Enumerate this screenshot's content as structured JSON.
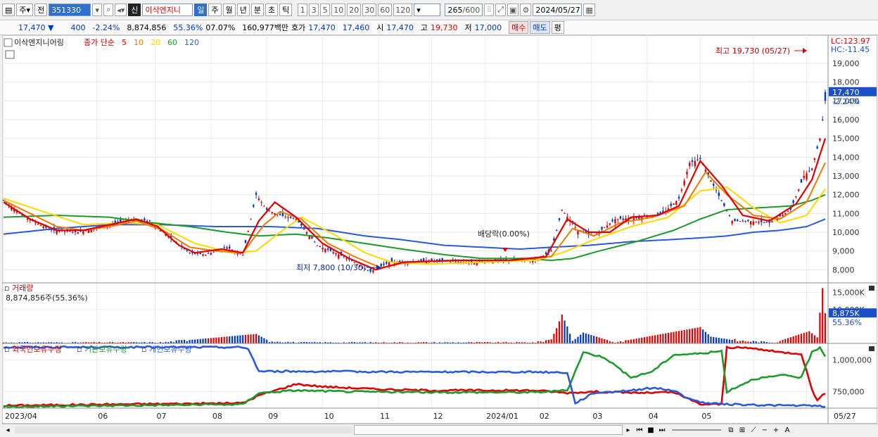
{
  "toolbar": {
    "market_btn": "주",
    "prev_btn": "전",
    "code": "351330",
    "stock_name": "이삭엔지니",
    "badge": "신",
    "periods": [
      "일",
      "주",
      "월",
      "년",
      "분",
      "초",
      "틱"
    ],
    "selected_period": "일",
    "intervals": [
      "1",
      "3",
      "5",
      "10",
      "20",
      "30",
      "60",
      "120"
    ],
    "count": "265",
    "count_total": "/600",
    "date": "2024/05/27"
  },
  "quote": {
    "price": "17,470",
    "arrow": "▼",
    "change": "400",
    "change_pct": "-2.24%",
    "volume": "8,874,856",
    "vol_ratio": "55.36%",
    "turnover": "07.07%",
    "amount": "160,977백만",
    "ask_label": "호가",
    "ask": "17,470",
    "bid": "17,460",
    "open_label": "시",
    "open": "17,470",
    "high_label": "고",
    "high": "19,730",
    "low_label": "저",
    "low": "17,000",
    "buy_btn": "매수",
    "sell_btn": "매도",
    "eval_btn": "평"
  },
  "colors": {
    "up": "#e00000",
    "down": "#0036c8",
    "ma5": "#e00000",
    "ma10": "#f07a00",
    "ma20": "#ffd800",
    "ma60": "#1e9a2c",
    "ma120": "#2a5ad8"
  },
  "chart_data": [
    {
      "type": "candlestick",
      "title": "이삭엔지니어링",
      "legend_label": "종가 단순",
      "ma_periods": [
        "5",
        "10",
        "20",
        "60",
        "120"
      ],
      "y_ticks": [
        "19,000",
        "18,000",
        "17,000",
        "16,000",
        "15,000",
        "14,000",
        "13,000",
        "12,000",
        "11,000",
        "10,000",
        "9,000",
        "8,000"
      ],
      "ylim": [
        7300,
        19900
      ],
      "lc_label": "LC:123.97",
      "hc_label": "HC:-11.45",
      "current_price_label": "17,470",
      "current_change_label": "-2.24%",
      "annotation_high": "최고 19,730 (05/27)",
      "annotation_low": "최저 7,800 (10/30)",
      "annotation_dividend": "배당락(0.00%)",
      "x_labels": [
        "2023/04",
        "06",
        "07",
        "08",
        "09",
        "10",
        "11",
        "12",
        "2024/01",
        "02",
        "03",
        "04",
        "05",
        "05/27"
      ],
      "price_path": [
        [
          0,
          11700
        ],
        [
          8,
          10800
        ],
        [
          18,
          10100
        ],
        [
          28,
          10000
        ],
        [
          38,
          10300
        ],
        [
          48,
          10700
        ],
        [
          55,
          10600
        ],
        [
          60,
          10000
        ],
        [
          70,
          8900
        ],
        [
          76,
          8800
        ],
        [
          84,
          9200
        ],
        [
          90,
          8800
        ],
        [
          95,
          12000
        ],
        [
          99,
          11200
        ],
        [
          104,
          10900
        ],
        [
          110,
          10700
        ],
        [
          118,
          9300
        ],
        [
          128,
          8700
        ],
        [
          138,
          7900
        ],
        [
          145,
          8400
        ],
        [
          160,
          8500
        ],
        [
          175,
          8400
        ],
        [
          188,
          8500
        ],
        [
          200,
          8500
        ],
        [
          206,
          9000
        ],
        [
          210,
          11200
        ],
        [
          216,
          10100
        ],
        [
          222,
          9800
        ],
        [
          230,
          10700
        ],
        [
          240,
          10800
        ],
        [
          248,
          11000
        ],
        [
          254,
          11800
        ],
        [
          258,
          13700
        ],
        [
          262,
          13900
        ],
        [
          268,
          12200
        ],
        [
          274,
          10600
        ],
        [
          280,
          10600
        ],
        [
          288,
          10500
        ],
        [
          296,
          11200
        ],
        [
          301,
          13000
        ],
        [
          304,
          13400
        ],
        [
          307,
          15000
        ],
        [
          309,
          17000
        ]
      ],
      "ma_series": {
        "ma5": [
          [
            0,
            11600
          ],
          [
            10,
            10700
          ],
          [
            20,
            10100
          ],
          [
            30,
            10100
          ],
          [
            40,
            10400
          ],
          [
            50,
            10700
          ],
          [
            58,
            10300
          ],
          [
            66,
            9300
          ],
          [
            72,
            8900
          ],
          [
            82,
            9100
          ],
          [
            90,
            8900
          ],
          [
            96,
            10600
          ],
          [
            102,
            11600
          ],
          [
            110,
            10800
          ],
          [
            120,
            9400
          ],
          [
            130,
            8600
          ],
          [
            140,
            8000
          ],
          [
            150,
            8400
          ],
          [
            170,
            8500
          ],
          [
            190,
            8500
          ],
          [
            204,
            8700
          ],
          [
            212,
            10700
          ],
          [
            220,
            10000
          ],
          [
            228,
            10000
          ],
          [
            236,
            10800
          ],
          [
            246,
            10900
          ],
          [
            254,
            11400
          ],
          [
            262,
            13800
          ],
          [
            270,
            12500
          ],
          [
            278,
            10900
          ],
          [
            288,
            10600
          ],
          [
            298,
            11500
          ],
          [
            304,
            12800
          ],
          [
            309,
            15000
          ]
        ],
        "ma10": [
          [
            0,
            11700
          ],
          [
            10,
            11000
          ],
          [
            20,
            10300
          ],
          [
            30,
            10100
          ],
          [
            40,
            10300
          ],
          [
            50,
            10600
          ],
          [
            60,
            10100
          ],
          [
            70,
            9200
          ],
          [
            80,
            9000
          ],
          [
            90,
            8900
          ],
          [
            98,
            10400
          ],
          [
            104,
            11100
          ],
          [
            112,
            10700
          ],
          [
            122,
            9400
          ],
          [
            132,
            8700
          ],
          [
            142,
            8100
          ],
          [
            152,
            8400
          ],
          [
            172,
            8500
          ],
          [
            192,
            8500
          ],
          [
            206,
            8700
          ],
          [
            214,
            10200
          ],
          [
            222,
            9800
          ],
          [
            232,
            10500
          ],
          [
            244,
            10800
          ],
          [
            256,
            11400
          ],
          [
            264,
            13200
          ],
          [
            272,
            12000
          ],
          [
            282,
            10900
          ],
          [
            292,
            10700
          ],
          [
            302,
            11600
          ],
          [
            309,
            13700
          ]
        ],
        "ma20": [
          [
            0,
            11800
          ],
          [
            15,
            11100
          ],
          [
            30,
            10400
          ],
          [
            45,
            10500
          ],
          [
            58,
            10400
          ],
          [
            72,
            9400
          ],
          [
            86,
            8900
          ],
          [
            95,
            9000
          ],
          [
            104,
            10000
          ],
          [
            112,
            10800
          ],
          [
            124,
            9900
          ],
          [
            136,
            8900
          ],
          [
            146,
            8400
          ],
          [
            160,
            8300
          ],
          [
            180,
            8400
          ],
          [
            200,
            8500
          ],
          [
            210,
            8900
          ],
          [
            222,
            9600
          ],
          [
            236,
            10300
          ],
          [
            250,
            10800
          ],
          [
            262,
            12200
          ],
          [
            272,
            12400
          ],
          [
            282,
            11300
          ],
          [
            292,
            10500
          ],
          [
            302,
            10900
          ],
          [
            309,
            12300
          ]
        ],
        "ma60": [
          [
            0,
            10800
          ],
          [
            20,
            10900
          ],
          [
            40,
            10800
          ],
          [
            56,
            10500
          ],
          [
            70,
            10300
          ],
          [
            84,
            10000
          ],
          [
            96,
            9800
          ],
          [
            110,
            9900
          ],
          [
            122,
            9700
          ],
          [
            136,
            9400
          ],
          [
            150,
            9100
          ],
          [
            166,
            8800
          ],
          [
            180,
            8600
          ],
          [
            196,
            8600
          ],
          [
            206,
            8500
          ],
          [
            214,
            8600
          ],
          [
            224,
            9000
          ],
          [
            238,
            9500
          ],
          [
            252,
            10100
          ],
          [
            262,
            10700
          ],
          [
            272,
            11200
          ],
          [
            284,
            11300
          ],
          [
            296,
            11400
          ],
          [
            304,
            11700
          ],
          [
            309,
            12000
          ]
        ],
        "ma120": [
          [
            0,
            9900
          ],
          [
            20,
            10200
          ],
          [
            40,
            10400
          ],
          [
            60,
            10400
          ],
          [
            80,
            10300
          ],
          [
            100,
            10300
          ],
          [
            118,
            10200
          ],
          [
            136,
            9800
          ],
          [
            150,
            9600
          ],
          [
            166,
            9300
          ],
          [
            180,
            9200
          ],
          [
            194,
            9100
          ],
          [
            206,
            9200
          ],
          [
            220,
            9300
          ],
          [
            236,
            9500
          ],
          [
            250,
            9600
          ],
          [
            262,
            9700
          ],
          [
            272,
            9800
          ],
          [
            282,
            10000
          ],
          [
            292,
            10100
          ],
          [
            302,
            10300
          ],
          [
            309,
            10700
          ]
        ]
      }
    },
    {
      "type": "bar",
      "title": "거래량",
      "subtitle": "8,874,856주(55.36%)",
      "y_ticks": [
        "15,000K",
        "10,000K"
      ],
      "current_label": "8,875K",
      "current_pct_label": "55.36%",
      "volume_k_path": [
        [
          0,
          300
        ],
        [
          60,
          300
        ],
        [
          95,
          2800
        ],
        [
          100,
          700
        ],
        [
          110,
          300
        ],
        [
          200,
          300
        ],
        [
          206,
          1200
        ],
        [
          208,
          4500
        ],
        [
          210,
          8500
        ],
        [
          212,
          5000
        ],
        [
          214,
          700
        ],
        [
          218,
          3200
        ],
        [
          230,
          300
        ],
        [
          262,
          4800
        ],
        [
          266,
          2000
        ],
        [
          276,
          800
        ],
        [
          290,
          300
        ],
        [
          303,
          3600
        ],
        [
          306,
          1800
        ],
        [
          308,
          16300
        ],
        [
          309,
          8875
        ]
      ]
    },
    {
      "type": "line",
      "title_series": [
        "외국인보유수량",
        "기관보유수량",
        "개인보유수량"
      ],
      "y_ticks": [
        "1,000,000",
        "750,000"
      ],
      "ylim": [
        620000,
        1130000
      ],
      "series": [
        {
          "name": "외국인보유수량",
          "color": "#e00000",
          "path": [
            [
              0,
              640000
            ],
            [
              40,
              650000
            ],
            [
              90,
              660000
            ],
            [
              96,
              720000
            ],
            [
              110,
              810000
            ],
            [
              120,
              790000
            ],
            [
              140,
              770000
            ],
            [
              160,
              760000
            ],
            [
              200,
              760000
            ],
            [
              212,
              740000
            ],
            [
              222,
              750000
            ],
            [
              240,
              740000
            ],
            [
              252,
              745000
            ],
            [
              262,
              650000
            ],
            [
              270,
              650000
            ],
            [
              272,
              1100000
            ],
            [
              282,
              1090000
            ],
            [
              292,
              1060000
            ],
            [
              300,
              1050000
            ],
            [
              304,
              770000
            ],
            [
              306,
              680000
            ],
            [
              309,
              740000
            ]
          ]
        },
        {
          "name": "기관보유수량",
          "color": "#1e9a2c",
          "path": [
            [
              0,
              630000
            ],
            [
              40,
              640000
            ],
            [
              90,
              650000
            ],
            [
              96,
              740000
            ],
            [
              110,
              760000
            ],
            [
              130,
              750000
            ],
            [
              160,
              745000
            ],
            [
              200,
              745000
            ],
            [
              212,
              760000
            ],
            [
              218,
              1060000
            ],
            [
              226,
              1020000
            ],
            [
              236,
              860000
            ],
            [
              244,
              910000
            ],
            [
              252,
              1040000
            ],
            [
              262,
              1050000
            ],
            [
              270,
              1070000
            ],
            [
              272,
              750000
            ],
            [
              282,
              850000
            ],
            [
              294,
              880000
            ],
            [
              300,
              860000
            ],
            [
              304,
              1060000
            ],
            [
              307,
              1100000
            ],
            [
              309,
              1030000
            ]
          ]
        },
        {
          "name": "개인보유수량",
          "color": "#2a5ad8",
          "path": [
            [
              0,
              1100000
            ],
            [
              88,
              1100000
            ],
            [
              92,
              1090000
            ],
            [
              96,
              910000
            ],
            [
              110,
              910000
            ],
            [
              160,
              905000
            ],
            [
              200,
              905000
            ],
            [
              212,
              900000
            ],
            [
              215,
              660000
            ],
            [
              222,
              740000
            ],
            [
              236,
              760000
            ],
            [
              244,
              780000
            ],
            [
              252,
              760000
            ],
            [
              258,
              690000
            ],
            [
              264,
              660000
            ],
            [
              272,
              650000
            ],
            [
              282,
              645000
            ],
            [
              300,
              640000
            ],
            [
              309,
              635000
            ]
          ]
        }
      ],
      "x_labels": [
        "2023/04",
        "06",
        "07",
        "08",
        "09",
        "10",
        "11",
        "12",
        "2024/01",
        "02",
        "03",
        "04",
        "05",
        "05/27"
      ]
    }
  ]
}
